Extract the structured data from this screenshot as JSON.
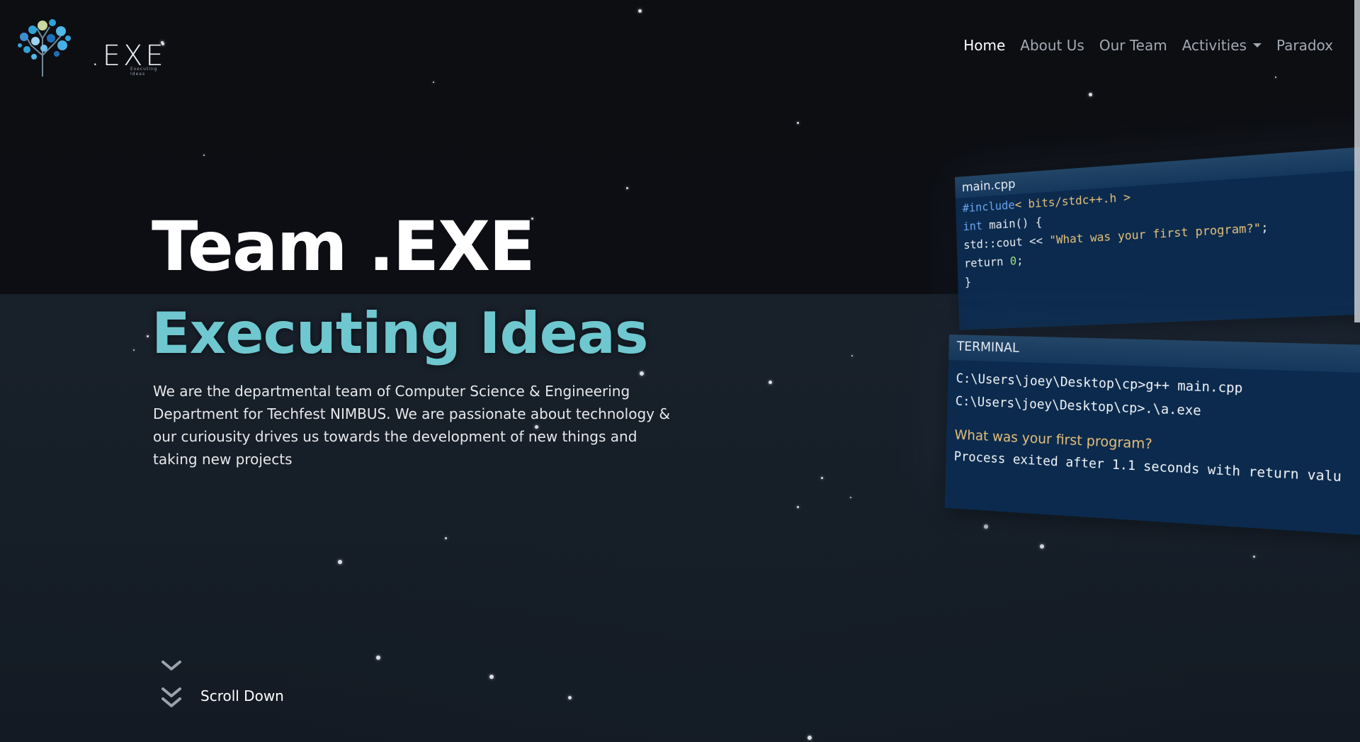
{
  "brand": {
    "logo_text": ".EXE",
    "logo_tagline": "Executing Ideas"
  },
  "nav": {
    "items": [
      {
        "label": "Home",
        "active": true
      },
      {
        "label": "About Us",
        "active": false
      },
      {
        "label": "Our Team",
        "active": false
      },
      {
        "label": "Activities",
        "active": false,
        "dropdown": true
      },
      {
        "label": "Paradox",
        "active": false
      }
    ]
  },
  "hero": {
    "title": "Team .EXE",
    "subtitle": "Executing Ideas",
    "description": "We are the departmental team of Computer Science & Engineering Department for Techfest NIMBUS. We are passionate about technology & our curiousity drives us towards the development of new things and taking new projects"
  },
  "scroll": {
    "label": "Scroll Down"
  },
  "editor": {
    "tab": "main.cpp",
    "lines": [
      {
        "kw": "#include",
        "rest": "< bits/stdc++.h >"
      },
      {
        "kw": "int",
        "rest": " main() {"
      },
      {
        "pre": "std::cout << ",
        "str": "\"What was your first program?\"",
        "post": ";"
      },
      {
        "pre": "return ",
        "num": "0",
        "post": ";"
      },
      {
        "pre": "}"
      }
    ]
  },
  "terminal": {
    "tab": "TERMINAL",
    "lines": [
      "C:\\Users\\joey\\Desktop\\cp>g++ main.cpp",
      "C:\\Users\\joey\\Desktop\\cp>.\\a.exe"
    ],
    "output": "What was your first program?",
    "exit_line": "Process exited after 1.1 seconds with return valu"
  },
  "colors": {
    "accent": "#6fc7cf",
    "panel": "#0b2a4d",
    "keyword": "#6aa5ee",
    "string": "#e6c07b"
  },
  "icons": {
    "logo": "tree-circuit-logo",
    "scroll": "chevron-down-icon"
  }
}
